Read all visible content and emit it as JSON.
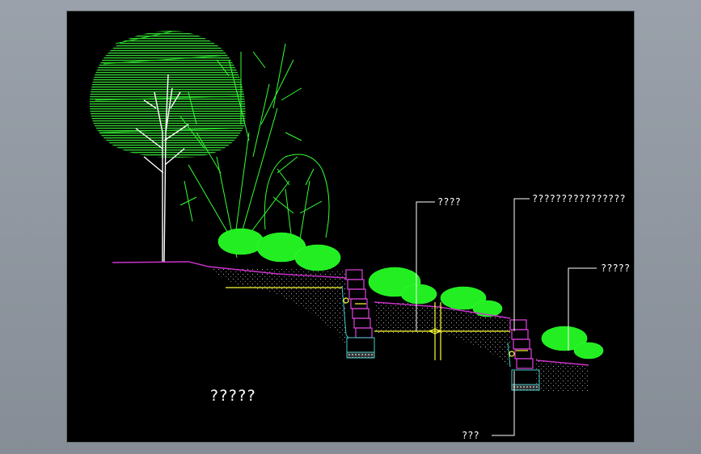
{
  "drawing": {
    "labels": {
      "top_left": "????",
      "top_right": "????????????????",
      "right": "?????",
      "bottom": "???",
      "title": "?????"
    },
    "colors": {
      "background": "#000000",
      "ground_line": "#cc33cc",
      "tree_fill": "#22dd22",
      "tree_line": "#33ff33",
      "trunk": "#ffffff",
      "wall_block": "#dd44dd",
      "water_line": "#ffff33",
      "base": "#44cccc",
      "leader": "#ffffff"
    }
  }
}
